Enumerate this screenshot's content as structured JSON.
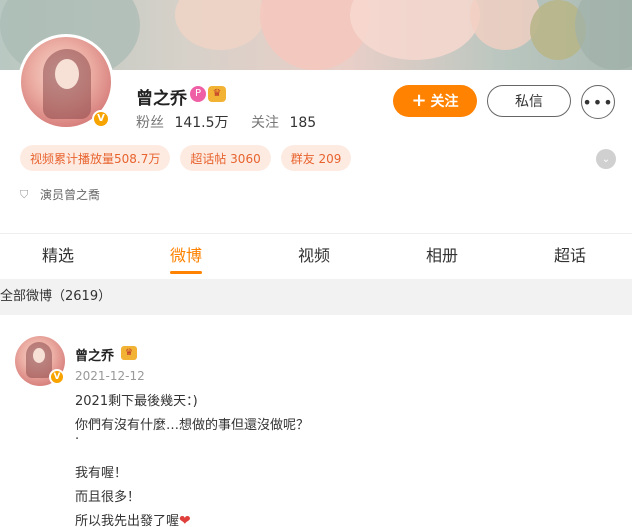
{
  "profile": {
    "name": "曾之乔",
    "followers_label": "粉丝",
    "followers_value": "141.5万",
    "following_label": "关注",
    "following_value": "185",
    "follow_button": "关注",
    "message_button": "私信",
    "description": "演员曾之喬",
    "chips": [
      {
        "label": "视频累计播放量508.7万"
      },
      {
        "label": "超话帖 3060"
      },
      {
        "label": "群友 209"
      }
    ]
  },
  "tabs": [
    {
      "label": "精选",
      "active": false
    },
    {
      "label": "微博",
      "active": true
    },
    {
      "label": "视频",
      "active": false
    },
    {
      "label": "相册",
      "active": false
    },
    {
      "label": "超话",
      "active": false
    }
  ],
  "section": {
    "title": "全部微博（2619）"
  },
  "post": {
    "author": "曾之乔",
    "time": "2021-12-12",
    "lines": [
      "2021剩下最後幾天：)",
      "你們有沒有什麼…想做的事但還沒做呢？",
      "·",
      "我有喔！",
      "而且很多！",
      "所以我先出發了喔"
    ]
  },
  "icons": {
    "verified": "verified-badge-icon",
    "heart": "heart-icon"
  },
  "colors": {
    "accent": "#ff8200",
    "chip_bg": "#fdebe2",
    "chip_text": "#e8632e"
  }
}
